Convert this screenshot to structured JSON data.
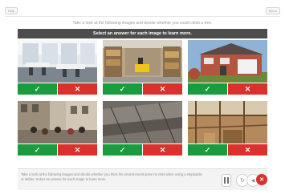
{
  "window": {
    "left_label": "Help",
    "right_label": "Menu"
  },
  "instruction": "Take a look at the following images and decide whether you could climb a tree.",
  "header": "Select an answer for each image to learn more.",
  "answers": {
    "yes_icon": "✓",
    "no_icon": "✕"
  },
  "images": [
    {
      "name": "office"
    },
    {
      "name": "warehouse"
    },
    {
      "name": "house"
    },
    {
      "name": "street-crowd"
    },
    {
      "name": "rooftop"
    },
    {
      "name": "construction-site"
    }
  ],
  "footer": {
    "text": "Take a look at the following images and decide whether you think the environments pose no risks when using a stepladder or ladder. Select an answer for each image to learn more.",
    "replay_icon": "↻",
    "volume_icon": "◀",
    "close_icon": "✕"
  },
  "colors": {
    "yes": "#1a9c3e",
    "no": "#d9312b",
    "header": "#4d4d4d"
  }
}
